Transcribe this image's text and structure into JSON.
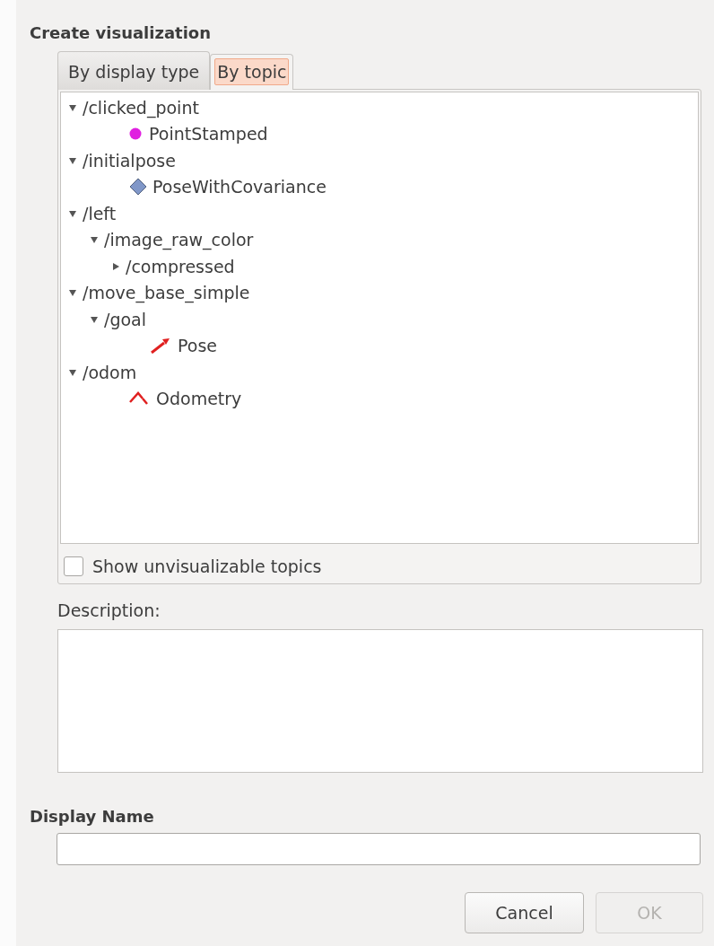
{
  "dialog": {
    "title": "Create visualization"
  },
  "tabs": [
    {
      "label": "By display type",
      "selected": false
    },
    {
      "label": "By topic",
      "selected": true
    }
  ],
  "tree": [
    {
      "label": "/clicked_point",
      "kind": "topic",
      "expanded": true,
      "children": [
        {
          "label": "PointStamped",
          "kind": "point"
        }
      ]
    },
    {
      "label": "/initialpose",
      "kind": "topic",
      "expanded": true,
      "children": [
        {
          "label": "PoseWithCovariance",
          "kind": "covariance"
        }
      ]
    },
    {
      "label": "/left",
      "kind": "topic",
      "expanded": true,
      "children": [
        {
          "label": "/image_raw_color",
          "kind": "topic",
          "expanded": true,
          "children": [
            {
              "label": "/compressed",
              "kind": "topic",
              "expanded": false
            }
          ]
        }
      ]
    },
    {
      "label": "/move_base_simple",
      "kind": "topic",
      "expanded": true,
      "children": [
        {
          "label": "/goal",
          "kind": "topic",
          "expanded": true,
          "children": [
            {
              "label": "Pose",
              "kind": "pose"
            }
          ]
        }
      ]
    },
    {
      "label": "/odom",
      "kind": "topic",
      "expanded": true,
      "children": [
        {
          "label": "Odometry",
          "kind": "odometry"
        }
      ]
    }
  ],
  "show_unvisualizable": {
    "label": "Show unvisualizable topics",
    "checked": false
  },
  "description": {
    "label": "Description:"
  },
  "display_name": {
    "label": "Display Name"
  },
  "buttons": [
    {
      "label": "Cancel",
      "disabled": false
    },
    {
      "label": "OK",
      "disabled": true
    }
  ]
}
